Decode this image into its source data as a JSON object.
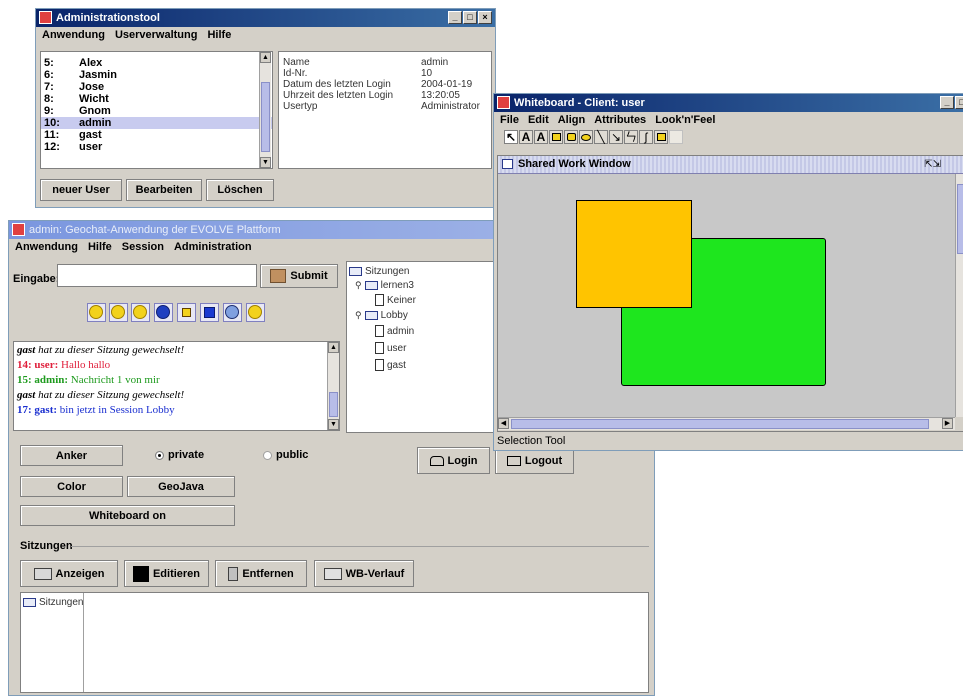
{
  "admin_tool": {
    "title": "Administrationstool",
    "menu": [
      "Anwendung",
      "Userverwaltung",
      "Hilfe"
    ],
    "users": [
      {
        "num": "5:",
        "name": "Alex"
      },
      {
        "num": "6:",
        "name": "Jasmin"
      },
      {
        "num": "7:",
        "name": "Jose"
      },
      {
        "num": "8:",
        "name": "Wicht"
      },
      {
        "num": "9:",
        "name": "Gnom"
      },
      {
        "num": "10:",
        "name": "admin"
      },
      {
        "num": "11:",
        "name": "gast"
      },
      {
        "num": "12:",
        "name": "user"
      }
    ],
    "selected_index": 5,
    "details": [
      {
        "key": "Name",
        "value": "admin"
      },
      {
        "key": "Id-Nr.",
        "value": "10"
      },
      {
        "key": "Datum des letzten Login",
        "value": "2004-01-19"
      },
      {
        "key": "Uhrzeit des letzten Login",
        "value": "13:20:05"
      },
      {
        "key": "Usertyp",
        "value": "Administrator"
      }
    ],
    "buttons": {
      "new": "neuer User",
      "edit": "Bearbeiten",
      "delete": "Löschen"
    }
  },
  "geochat": {
    "title": "admin: Geochat-Anwendung der EVOLVE Plattform",
    "menu": [
      "Anwendung",
      "Hilfe",
      "Session",
      "Administration"
    ],
    "input_label": "Eingabe:",
    "input_value": "",
    "submit_label": "Submit",
    "emoticons": [
      "happy-emoticon",
      "smile-emoticon",
      "neutral-emoticon",
      "question-emoticon",
      "note-emoticon",
      "info-emoticon",
      "stop-emoticon",
      "sad-emoticon"
    ],
    "messages": [
      {
        "prefix": "gast",
        "text": " hat zu dieser Sitzung gewechselt!",
        "color": "#000000",
        "style": "italic"
      },
      {
        "prefix": "14: user:",
        "text": " Hallo hallo",
        "color": "#e0203c",
        "style": "normal"
      },
      {
        "prefix": "15: admin:",
        "text": " Nachricht 1 von mir",
        "color": "#1d9a1d",
        "style": "normal"
      },
      {
        "prefix": "gast",
        "text": " hat zu dieser Sitzung gewechselt!",
        "color": "#000000",
        "style": "italic"
      },
      {
        "prefix": "17: gast:",
        "text": " bin jetzt in Session Lobby",
        "color": "#1a2fd0",
        "style": "normal"
      }
    ],
    "tree": {
      "root": "Sitzungen",
      "sessions": [
        {
          "name": "lernen3",
          "members": [
            "Keiner"
          ]
        },
        {
          "name": "Lobby",
          "members": [
            "admin",
            "user",
            "gast"
          ]
        }
      ]
    },
    "anker_label": "Anker",
    "radio_private": "private",
    "radio_public": "public",
    "login_label": "Login",
    "logout_label": "Logout",
    "color_label": "Color",
    "geojava_label": "GeoJava",
    "whiteboard_label": "Whiteboard on",
    "sessions_group_label": "Sitzungen",
    "anzeigen_label": "Anzeigen",
    "editieren_label": "Editieren",
    "entfernen_label": "Entfernen",
    "wbverlauf_label": "WB-Verlauf",
    "bottom_tree_root": "Sitzungen"
  },
  "whiteboard": {
    "title": "Whiteboard - Client: user",
    "menu": [
      "File",
      "Edit",
      "Align",
      "Attributes",
      "Look'n'Feel"
    ],
    "tools": [
      "select-tool-icon",
      "text-tool-icon",
      "text-alt-tool-icon",
      "rect-tool-icon",
      "round-rect-tool-icon",
      "ellipse-tool-icon",
      "line-tool-icon",
      "elbow-line-tool-icon",
      "connector-tool-icon",
      "scribble-tool-icon",
      "polygon-tool-icon",
      "image-tool-icon"
    ],
    "shared_window_title": "Shared Work Window",
    "status": "Selection Tool",
    "colors": {
      "orange": "#ffc400",
      "green": "#1ee61e",
      "canvas": "#c8c8c8"
    }
  }
}
